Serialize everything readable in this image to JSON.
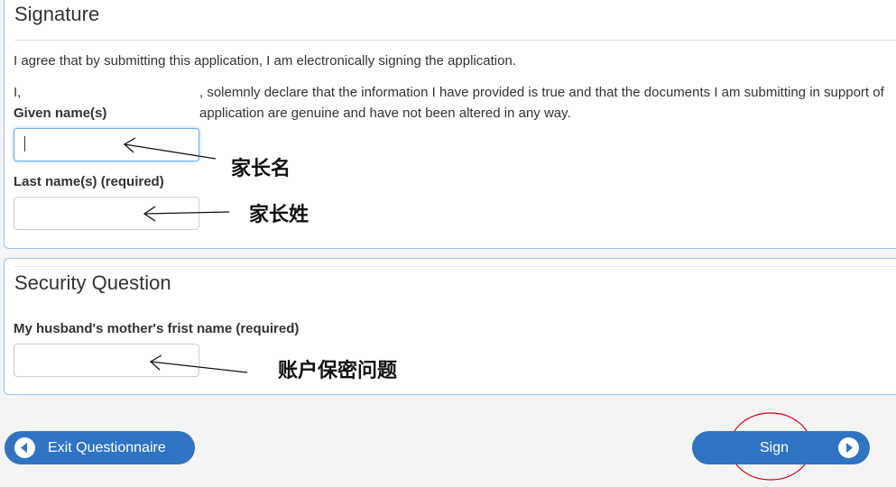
{
  "signature": {
    "title": "Signature",
    "agreement_text": "I agree that by submitting this application, I am electronically signing the application.",
    "declaration_prefix": "I,",
    "declaration_line1": ", solemnly declare that the information I have provided is true and that the documents I am submitting in support of",
    "declaration_line2": "application are genuine and have not been altered in any way.",
    "given_label": "Given name(s)",
    "given_value": "",
    "last_label": "Last name(s) (required)",
    "last_value": ""
  },
  "security": {
    "title": "Security Question",
    "question_label": "My husband's mother's frist name (required)",
    "answer_value": ""
  },
  "annotations": {
    "given_note": "家长名",
    "last_note": "家长姓",
    "security_note": "账户保密问题"
  },
  "buttons": {
    "exit_label": "Exit Questionnaire",
    "sign_label": "Sign"
  },
  "colors": {
    "button_blue": "#2f73c3",
    "panel_border": "#9fc5e8",
    "annotation_circle": "#d0021b"
  }
}
